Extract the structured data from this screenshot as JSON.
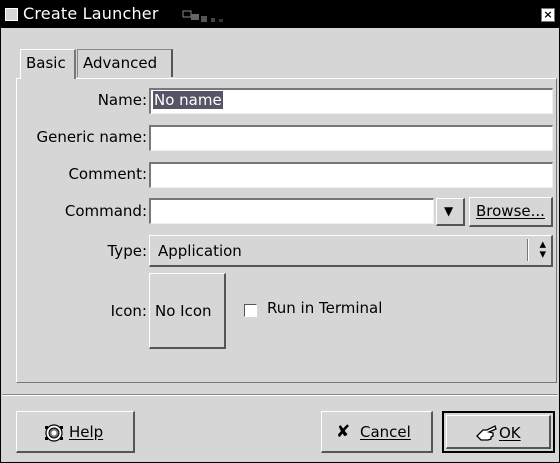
{
  "window": {
    "title": "Create Launcher"
  },
  "tabs": [
    {
      "label": "Basic"
    },
    {
      "label": "Advanced"
    }
  ],
  "form": {
    "name_label": "Name:",
    "name_value": "No name",
    "generic_name_label": "Generic name:",
    "generic_name_value": "",
    "comment_label": "Comment:",
    "comment_value": "",
    "command_label": "Command:",
    "command_value": "",
    "browse_label": "Browse...",
    "type_label": "Type:",
    "type_value": "Application",
    "icon_label": "Icon:",
    "icon_button_label": "No Icon",
    "run_in_terminal_label": "Run in Terminal",
    "run_in_terminal_checked": false
  },
  "buttons": {
    "help": "Help",
    "cancel": "Cancel",
    "ok": "OK"
  }
}
